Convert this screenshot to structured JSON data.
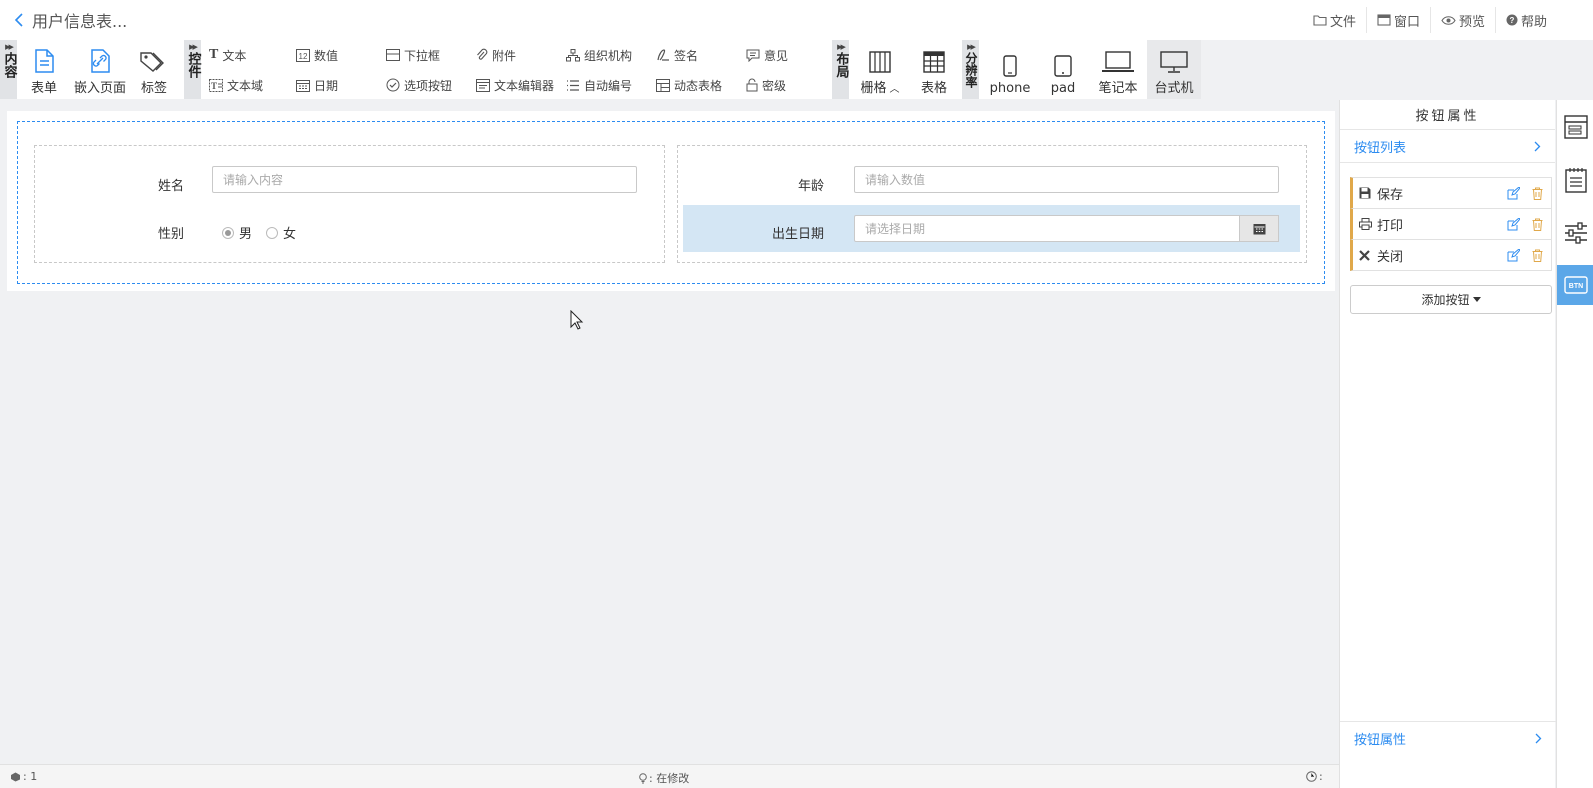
{
  "header": {
    "title": "用户信息表..."
  },
  "top_menu": [
    {
      "label": "文件",
      "icon": "folder-icon"
    },
    {
      "label": "窗口",
      "icon": "window-icon"
    },
    {
      "label": "预览",
      "icon": "eye-icon"
    },
    {
      "label": "帮助",
      "icon": "help-icon"
    }
  ],
  "toolbar": {
    "content_group": {
      "label": "内容",
      "items": [
        "表单",
        "嵌入页面",
        "标签"
      ]
    },
    "controls_group": {
      "label": "控件",
      "items": [
        "文本",
        "数值",
        "下拉框",
        "附件",
        "组织机构",
        "签名",
        "意见",
        "文本域",
        "日期",
        "选项按钮",
        "文本编辑器",
        "自动编号",
        "动态表格",
        "密级"
      ]
    },
    "layout_group": {
      "label": "布局",
      "items": [
        "栅格",
        "表格"
      ]
    },
    "resolution_group": {
      "label": "分辨率",
      "items": [
        "phone",
        "pad",
        "笔记本",
        "台式机"
      ],
      "active": "台式机"
    }
  },
  "form": {
    "name_label": "姓名",
    "name_placeholder": "请输入内容",
    "gender_label": "性别",
    "gender_options": [
      "男",
      "女"
    ],
    "gender_selected": "男",
    "age_label": "年龄",
    "age_placeholder": "请输入数值",
    "birth_label": "出生日期",
    "birth_placeholder": "请选择日期"
  },
  "right_panel": {
    "title": "按钮属性",
    "list_header": "按钮列表",
    "buttons": [
      {
        "label": "保存",
        "icon": "save-icon"
      },
      {
        "label": "打印",
        "icon": "print-icon"
      },
      {
        "label": "关闭",
        "icon": "close-icon"
      }
    ],
    "add_button": "添加按钮",
    "footer": "按钮属性"
  },
  "status_bar": {
    "count": ": 1",
    "status": ": 在修改",
    "time": ":"
  },
  "colors": {
    "accent": "#2d8cf0",
    "highlight": "#d4e6f4",
    "active_tab": "#5ba7e8",
    "delete": "#e0a84a"
  }
}
